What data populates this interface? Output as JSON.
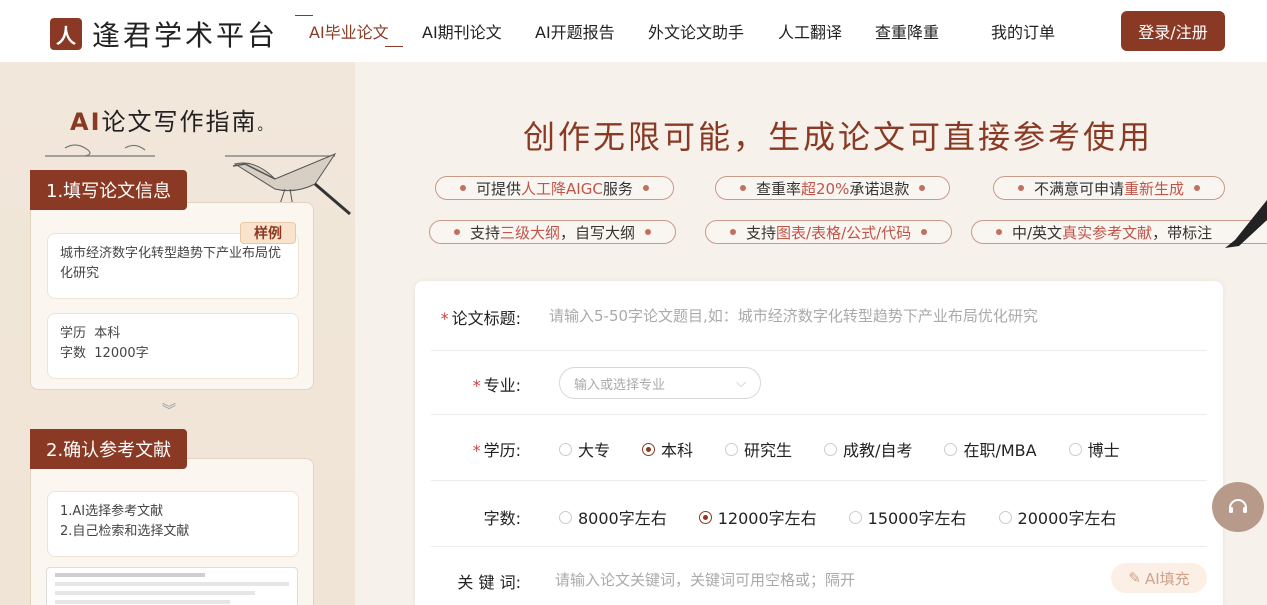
{
  "header": {
    "logo_mark": "人",
    "logo_text": "逢君学术平台",
    "nav": [
      "AI毕业论文",
      "AI期刊论文",
      "AI开题报告",
      "外文论文助手",
      "人工翻译",
      "查重降重",
      "我的订单"
    ],
    "login": "登录/注册"
  },
  "sidebar": {
    "title_ai": "AI",
    "title_rest": "论文写作指南",
    "step1": "1.填写论文信息",
    "sample_badge": "样例",
    "sample_title": "城市经济数字化转型趋势下产业布局优化研究",
    "edu_label": "学历",
    "edu_value": "本科",
    "words_label": "字数",
    "words_value": "12000字",
    "step2": "2.确认参考文献",
    "ref_option1": "1.AI选择参考文献",
    "ref_option2": "2.自己检索和选择文献"
  },
  "main": {
    "headline": "创作无限可能，生成论文可直接参考使用",
    "pills": [
      {
        "pre": "可提供",
        "hl": "人工降AIGC",
        "post": "服务"
      },
      {
        "pre": "查重率",
        "hl": "超20%",
        "post": "承诺退款"
      },
      {
        "pre": "不满意可申请",
        "hl": "重新生成",
        "post": ""
      },
      {
        "pre": "支持",
        "hl": "三级大纲",
        "post": "，自写大纲"
      },
      {
        "pre": "支持",
        "hl": "图表/表格/公式/代码",
        "post": ""
      },
      {
        "pre": "中/英文",
        "hl": "真实参考文献",
        "post": "，带标注"
      }
    ]
  },
  "form": {
    "title_label": "论文标题:",
    "title_placeholder": "请输入5-50字论文题目,如：城市经济数字化转型趋势下产业布局优化研究",
    "major_label": "专业:",
    "major_placeholder": "输入或选择专业",
    "edu_label": "学历:",
    "edu_options": [
      "大专",
      "本科",
      "研究生",
      "成教/自考",
      "在职/MBA",
      "博士"
    ],
    "edu_selected": "本科",
    "words_label": "字数:",
    "words_options": [
      "8000字左右",
      "12000字左右",
      "15000字左右",
      "20000字左右"
    ],
    "words_selected": "12000字左右",
    "keywords_label": "关 键 词:",
    "keywords_placeholder": "请输入论文关键词，关键词可用空格或；隔开",
    "ai_fill": "AI填充"
  },
  "colors": {
    "brand": "#8a3a24",
    "highlight": "#c0554a"
  }
}
